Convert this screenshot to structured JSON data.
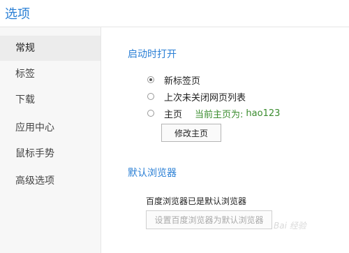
{
  "header": {
    "title": "选项"
  },
  "sidebar": {
    "items": [
      {
        "label": "常规",
        "active": true
      },
      {
        "label": "标签",
        "active": false
      },
      {
        "label": "下载",
        "active": false
      },
      {
        "label": "应用中心",
        "active": false
      },
      {
        "label": "鼠标手势",
        "active": false
      },
      {
        "label": "高级选项",
        "active": false
      }
    ]
  },
  "startup": {
    "title": "启动时打开",
    "options": [
      {
        "label": "新标签页",
        "checked": true
      },
      {
        "label": "上次未关闭网页列表",
        "checked": false
      },
      {
        "label": "主页",
        "checked": false
      }
    ],
    "homepage_prefix": "当前主页为:",
    "homepage_value": "hao123",
    "change_homepage_button": "修改主页"
  },
  "default_browser": {
    "title": "默认浏览器",
    "status": "百度浏览器已是默认浏览器",
    "set_default_button": "设置百度浏览器为默认浏览器"
  },
  "watermark": {
    "text": "Bai 经验"
  }
}
